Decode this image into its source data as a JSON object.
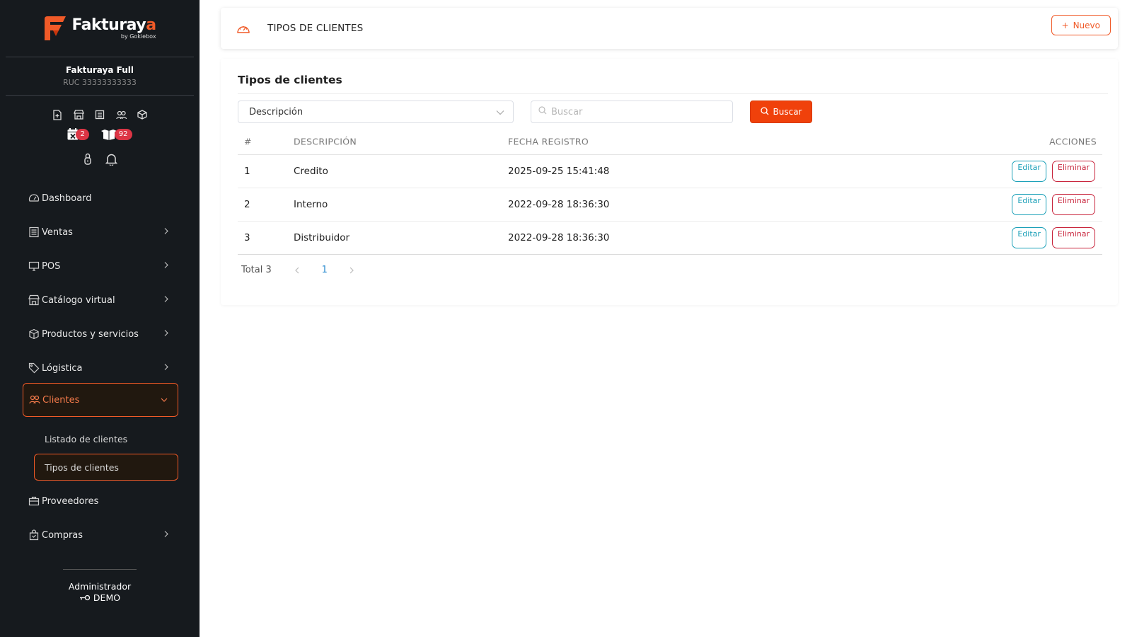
{
  "brand": {
    "name_main": "Fakturay",
    "name_accent": "a",
    "byline": "by Gokiebox"
  },
  "company": {
    "name": "Fakturaya Full",
    "ruc": "RUC 33333333333"
  },
  "quick_icons": [
    "file-plus-icon",
    "store-icon",
    "document-list-icon",
    "users-icon",
    "box-icon"
  ],
  "badges": [
    {
      "icon": "calendar-x-icon",
      "count": "2"
    },
    {
      "icon": "boxes-icon",
      "count": "92"
    }
  ],
  "sidebar": {
    "items": [
      {
        "label": "Dashboard",
        "icon": "gauge-icon",
        "chevron": false
      },
      {
        "label": "Ventas",
        "icon": "receipt-icon",
        "chevron": true
      },
      {
        "label": "POS",
        "icon": "monitor-icon",
        "chevron": true
      },
      {
        "label": "Catálogo virtual",
        "icon": "store-icon",
        "chevron": true
      },
      {
        "label": "Productos y servicios",
        "icon": "box-icon",
        "chevron": true
      },
      {
        "label": "Lógistica",
        "icon": "tag-icon",
        "chevron": true
      },
      {
        "label": "Clientes",
        "icon": "users-icon",
        "chevron": true,
        "expanded": true
      },
      {
        "label": "Proveedores",
        "icon": "briefcase-icon",
        "chevron": false
      },
      {
        "label": "Compras",
        "icon": "shopping-bag-icon",
        "chevron": true
      }
    ],
    "subitems": [
      {
        "label": "Listado de clientes"
      },
      {
        "label": "Tipos de clientes",
        "active": true
      }
    ]
  },
  "user": {
    "role": "Administrador",
    "name": "DEMO"
  },
  "header": {
    "title": "TIPOS DE CLIENTES",
    "new_button": "Nuevo",
    "new_prefix": "+"
  },
  "content": {
    "title": "Tipos de clientes",
    "filter_select": "Descripción",
    "search_placeholder": "Buscar",
    "search_button": "Buscar"
  },
  "table": {
    "columns": [
      "#",
      "DESCRIPCIÓN",
      "FECHA REGISTRO",
      "ACCIONES"
    ],
    "rows": [
      {
        "num": "1",
        "desc": "Credito",
        "date": "2025-09-25 15:41:48"
      },
      {
        "num": "2",
        "desc": "Interno",
        "date": "2022-09-28 18:36:30"
      },
      {
        "num": "3",
        "desc": "Distribuidor",
        "date": "2022-09-28 18:36:30"
      }
    ],
    "edit_label": "Editar",
    "delete_label": "Eliminar"
  },
  "pagination": {
    "total": "Total 3",
    "page": "1"
  },
  "colors": {
    "accent": "#f05a28",
    "sidebar_bg": "#161a1e",
    "edit": "#1ba0b8",
    "delete": "#c8243c",
    "page_link": "#2d8cd0"
  }
}
